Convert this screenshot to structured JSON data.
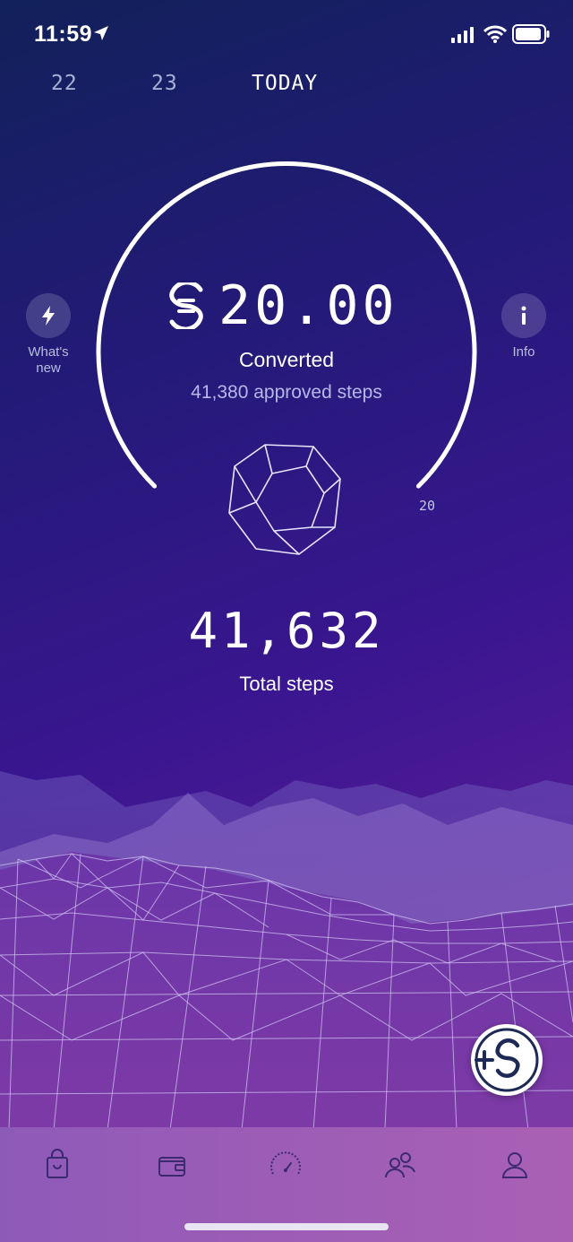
{
  "status_bar": {
    "time": "11:59"
  },
  "date_tabs": [
    {
      "label": "22"
    },
    {
      "label": "23"
    },
    {
      "label": "TODAY"
    }
  ],
  "whats_new": {
    "label_line1": "What's",
    "label_line2": "new",
    "icon": "lightning-icon"
  },
  "info": {
    "label": "Info",
    "icon": "info-icon"
  },
  "gauge": {
    "amount": "20.00",
    "currency_icon": "sweatcoin-icon",
    "converted_label": "Converted",
    "approved_steps": "41,380 approved steps",
    "max_label": "20"
  },
  "steps": {
    "total": "41,632",
    "label": "Total steps"
  },
  "nav": [
    {
      "name": "shop",
      "icon": "shopping-bag-icon"
    },
    {
      "name": "wallet",
      "icon": "wallet-icon"
    },
    {
      "name": "speedometer",
      "icon": "speedometer-icon"
    },
    {
      "name": "friends",
      "icon": "friends-icon"
    },
    {
      "name": "profile",
      "icon": "profile-icon"
    }
  ],
  "colors": {
    "background_top": "#12215a",
    "background_bottom": "#6c2aa0",
    "navbar": "#9d5db6",
    "accent_text": "#b7b7e8"
  }
}
